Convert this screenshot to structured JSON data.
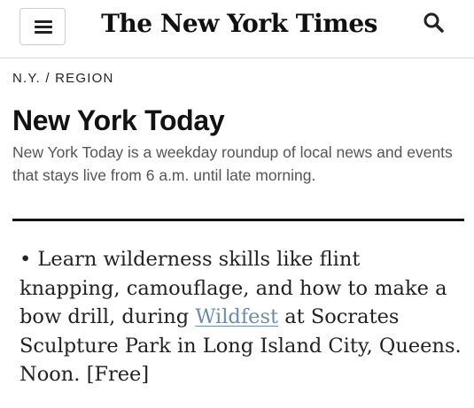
{
  "header": {
    "logo_text": "The New York Times",
    "menu_icon": "hamburger-menu-icon",
    "search_icon": "search-icon"
  },
  "section": {
    "breadcrumb": "N.Y. / REGION"
  },
  "article": {
    "title": "New York Today",
    "summary": "New York Today is a weekday roundup of local news and events that stays live from 6 a.m. until late morning.",
    "item": {
      "bullet": "•",
      "text_before": " Learn wilderness skills like flint knapping, camouflage, and how to make a bow drill, during ",
      "link_text": "Wildfest",
      "text_after": " at Socrates Sculpture Park in Long Island City, Queens. Noon. [Free]"
    }
  },
  "colors": {
    "link": "#6d8aa6",
    "rule": "#121212",
    "summary_text": "#555555"
  }
}
